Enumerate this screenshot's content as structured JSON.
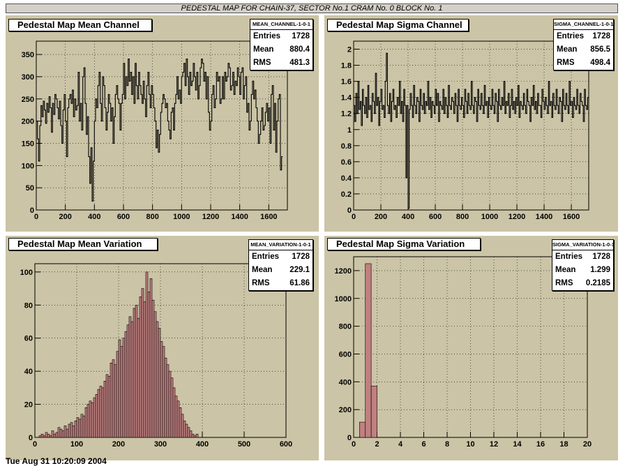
{
  "page_title": "PEDESTAL MAP FOR CHAIN-37, SECTOR No.1 CRAM No. 0 BLOCK No. 1",
  "footer_text": "Tue Aug 31 10:20:09 2004",
  "pads": [
    {
      "title": "Pedestal Map Mean Channel",
      "stats": {
        "name": "MEAN_CHANNEL-1-0-1",
        "entries_label": "Entries",
        "entries": "1728",
        "mean_label": "Mean",
        "mean": "880.4",
        "rms_label": "RMS",
        "rms": "481.3"
      }
    },
    {
      "title": "Pedestal Map Sigma Channel",
      "stats": {
        "name": "SIGMA_CHANNEL-1-0-1",
        "entries_label": "Entries",
        "entries": "1728",
        "mean_label": "Mean",
        "mean": "856.5",
        "rms_label": "RMS",
        "rms": "498.4"
      }
    },
    {
      "title": "Pedestal Map Mean Variation",
      "stats": {
        "name": "MEAN_VARIATION-1-0-1",
        "entries_label": "Entries",
        "entries": "1728",
        "mean_label": "Mean",
        "mean": "229.1",
        "rms_label": "RMS",
        "rms": "61.86"
      }
    },
    {
      "title": "Pedestal Map Sigma Variation",
      "stats": {
        "name": "SIGMA_VARIATION-1-0-1",
        "entries_label": "Entries",
        "entries": "1728",
        "mean_label": "Mean",
        "mean": "1.299",
        "rms_label": "RMS",
        "rms": "0.2185"
      }
    }
  ],
  "colors": {
    "pad_background": "#cbc4a6",
    "hist_fill": "#c08080",
    "line": "#000000"
  },
  "chart_data": [
    {
      "type": "line",
      "title": "Pedestal Map Mean Channel",
      "xlim": [
        0,
        1728
      ],
      "ylim": [
        0,
        380
      ],
      "xticks": [
        "0",
        "200",
        "400",
        "600",
        "800",
        "1000",
        "1200",
        "1400",
        "1600"
      ],
      "yticks": [
        "0",
        "50",
        "100",
        "150",
        "200",
        "250",
        "300",
        "350"
      ],
      "grid": true,
      "bin_width": 8,
      "x": [
        0,
        8,
        16,
        24,
        32,
        40,
        48,
        56,
        64,
        72,
        80,
        88,
        96,
        104,
        112,
        120,
        128,
        136,
        144,
        152,
        160,
        168,
        176,
        184,
        192,
        200,
        208,
        216,
        224,
        232,
        240,
        248,
        256,
        264,
        272,
        280,
        288,
        296,
        304,
        312,
        320,
        328,
        336,
        344,
        352,
        360,
        368,
        376,
        384,
        392,
        400,
        408,
        416,
        424,
        432,
        440,
        448,
        456,
        464,
        472,
        480,
        488,
        496,
        504,
        512,
        520,
        528,
        536,
        544,
        552,
        560,
        568,
        576,
        584,
        592,
        600,
        608,
        616,
        624,
        632,
        640,
        648,
        656,
        664,
        672,
        680,
        688,
        696,
        704,
        712,
        720,
        728,
        736,
        744,
        752,
        760,
        768,
        776,
        784,
        792,
        800,
        808,
        816,
        824,
        832,
        840,
        848,
        856,
        864,
        872,
        880,
        888,
        896,
        904,
        912,
        920,
        928,
        936,
        944,
        952,
        960,
        968,
        976,
        984,
        992,
        1000,
        1008,
        1016,
        1024,
        1032,
        1040,
        1048,
        1056,
        1064,
        1072,
        1080,
        1088,
        1096,
        1104,
        1112,
        1120,
        1128,
        1136,
        1144,
        1152,
        1160,
        1168,
        1176,
        1184,
        1192,
        1200,
        1208,
        1216,
        1224,
        1232,
        1240,
        1248,
        1256,
        1264,
        1272,
        1280,
        1288,
        1296,
        1304,
        1312,
        1320,
        1328,
        1336,
        1344,
        1352,
        1360,
        1368,
        1376,
        1384,
        1392,
        1400,
        1408,
        1416,
        1424,
        1432,
        1440,
        1448,
        1456,
        1464,
        1472,
        1480,
        1488,
        1496,
        1504,
        1512,
        1520,
        1528,
        1536,
        1544,
        1552,
        1560,
        1568,
        1576,
        1584,
        1592,
        1600,
        1608,
        1616,
        1624,
        1632,
        1640,
        1648,
        1656,
        1664,
        1672,
        1680,
        1688,
        1696,
        1704,
        1712,
        1720
      ],
      "series": [
        {
          "values": [
            200,
            160,
            110,
            190,
            235,
            210,
            245,
            225,
            195,
            240,
            220,
            255,
            230,
            175,
            240,
            215,
            260,
            250,
            230,
            205,
            245,
            190,
            150,
            225,
            260,
            200,
            120,
            230,
            250,
            260,
            240,
            270,
            210,
            250,
            225,
            235,
            310,
            200,
            240,
            180,
            300,
            320,
            240,
            170,
            210,
            120,
            60,
            140,
            20,
            110,
            200,
            250,
            230,
            280,
            310,
            240,
            200,
            300,
            280,
            230,
            180,
            220,
            260,
            240,
            200,
            230,
            150,
            210,
            260,
            280,
            250,
            240,
            180,
            240,
            260,
            330,
            250,
            300,
            280,
            340,
            290,
            310,
            260,
            300,
            240,
            330,
            280,
            250,
            310,
            280,
            260,
            240,
            290,
            250,
            210,
            280,
            310,
            260,
            230,
            280,
            260,
            230,
            200,
            140,
            180,
            130,
            170,
            220,
            240,
            260,
            250,
            230,
            240,
            200,
            180,
            160,
            220,
            230,
            180,
            240,
            260,
            300,
            250,
            270,
            240,
            300,
            310,
            330,
            280,
            340,
            300,
            260,
            310,
            280,
            290,
            330,
            300,
            270,
            310,
            250,
            280,
            320,
            340,
            330,
            290,
            310,
            250,
            300,
            220,
            180,
            200,
            260,
            280,
            230,
            250,
            310,
            290,
            300,
            240,
            250,
            300,
            250,
            310,
            290,
            300,
            330,
            320,
            270,
            280,
            310,
            260,
            290,
            280,
            320,
            300,
            260,
            310,
            320,
            250,
            280,
            300,
            220,
            240,
            180,
            200,
            260,
            290,
            250,
            270,
            230,
            200,
            150,
            170,
            200,
            230,
            180,
            190,
            220,
            240,
            200,
            230,
            150,
            260,
            280,
            180,
            240,
            130,
            200,
            250,
            260,
            90,
            120
          ]
        }
      ]
    },
    {
      "type": "line",
      "title": "Pedestal Map Sigma Channel",
      "xlim": [
        0,
        1728
      ],
      "ylim": [
        0,
        2.1
      ],
      "xticks": [
        "0",
        "200",
        "400",
        "600",
        "800",
        "1000",
        "1200",
        "1400",
        "1600"
      ],
      "yticks": [
        "0",
        "0.2",
        "0.4",
        "0.6",
        "0.8",
        "1",
        "1.2",
        "1.4",
        "1.6",
        "1.8",
        "2"
      ],
      "grid": true,
      "bin_width": 8,
      "x": [
        0,
        8,
        16,
        24,
        32,
        40,
        48,
        56,
        64,
        72,
        80,
        88,
        96,
        104,
        112,
        120,
        128,
        136,
        144,
        152,
        160,
        168,
        176,
        184,
        192,
        200,
        208,
        216,
        224,
        232,
        240,
        248,
        256,
        264,
        272,
        280,
        288,
        296,
        304,
        312,
        320,
        328,
        336,
        344,
        352,
        360,
        368,
        376,
        384,
        392,
        400,
        408,
        416,
        424,
        432,
        440,
        448,
        456,
        464,
        472,
        480,
        488,
        496,
        504,
        512,
        520,
        528,
        536,
        544,
        552,
        560,
        568,
        576,
        584,
        592,
        600,
        608,
        616,
        624,
        632,
        640,
        648,
        656,
        664,
        672,
        680,
        688,
        696,
        704,
        712,
        720,
        728,
        736,
        744,
        752,
        760,
        768,
        776,
        784,
        792,
        800,
        808,
        816,
        824,
        832,
        840,
        848,
        856,
        864,
        872,
        880,
        888,
        896,
        904,
        912,
        920,
        928,
        936,
        944,
        952,
        960,
        968,
        976,
        984,
        992,
        1000,
        1008,
        1016,
        1024,
        1032,
        1040,
        1048,
        1056,
        1064,
        1072,
        1080,
        1088,
        1096,
        1104,
        1112,
        1120,
        1128,
        1136,
        1144,
        1152,
        1160,
        1168,
        1176,
        1184,
        1192,
        1200,
        1208,
        1216,
        1224,
        1232,
        1240,
        1248,
        1256,
        1264,
        1272,
        1280,
        1288,
        1296,
        1304,
        1312,
        1320,
        1328,
        1336,
        1344,
        1352,
        1360,
        1368,
        1376,
        1384,
        1392,
        1400,
        1408,
        1416,
        1424,
        1432,
        1440,
        1448,
        1456,
        1464,
        1472,
        1480,
        1488,
        1496,
        1504,
        1512,
        1520,
        1528,
        1536,
        1544,
        1552,
        1560,
        1568,
        1576,
        1584,
        1592,
        1600,
        1608,
        1616,
        1624,
        1632,
        1640,
        1648,
        1656,
        1664,
        1672,
        1680,
        1688,
        1696,
        1704,
        1712,
        1720
      ],
      "series": [
        {
          "values": [
            1.3,
            1.1,
            1.45,
            1.2,
            1.6,
            1.25,
            1.35,
            1.05,
            1.5,
            1.3,
            1.2,
            1.4,
            1.15,
            1.55,
            1.25,
            1.3,
            1.1,
            1.45,
            1.35,
            1.2,
            1.7,
            1.3,
            1.4,
            1.05,
            1.35,
            1.5,
            1.25,
            1.3,
            1.15,
            1.6,
            1.95,
            1.3,
            1.2,
            1.45,
            1.1,
            1.35,
            1.5,
            1.25,
            1.3,
            1.15,
            1.4,
            1.3,
            1.6,
            1.2,
            1.35,
            1.1,
            1.5,
            1.3,
            0.4,
            1.3,
            0.02,
            1.25,
            1.45,
            1.3,
            1.15,
            1.55,
            1.3,
            1.2,
            1.4,
            1.35,
            1.1,
            1.5,
            1.3,
            1.25,
            1.45,
            1.2,
            1.35,
            1.3,
            1.6,
            1.25,
            1.4,
            1.15,
            1.35,
            1.3,
            1.2,
            1.5,
            1.3,
            1.45,
            1.1,
            1.35,
            1.3,
            1.25,
            1.5,
            1.2,
            1.4,
            1.3,
            1.15,
            1.55,
            1.3,
            1.25,
            1.4,
            1.35,
            1.2,
            1.45,
            1.3,
            1.1,
            1.5,
            1.3,
            1.25,
            1.4,
            1.3,
            1.15,
            1.5,
            1.35,
            1.2,
            1.45,
            1.3,
            1.25,
            1.6,
            1.3,
            1.2,
            1.4,
            1.35,
            1.1,
            1.5,
            1.3,
            1.25,
            1.45,
            1.3,
            1.2,
            1.55,
            1.3,
            1.35,
            1.15,
            1.4,
            1.3,
            1.25,
            1.5,
            1.3,
            1.2,
            1.45,
            1.35,
            1.1,
            1.5,
            1.3,
            1.25,
            1.4,
            1.3,
            1.6,
            1.2,
            1.35,
            1.3,
            1.45,
            1.15,
            1.3,
            1.5,
            1.25,
            1.35,
            1.2,
            1.4,
            1.3,
            1.55,
            1.15,
            1.35,
            1.3,
            1.25,
            1.45,
            1.3,
            1.2,
            1.5,
            1.35,
            1.3,
            1.1,
            1.4,
            1.3,
            1.55,
            1.25,
            1.35,
            1.2,
            1.45,
            1.3,
            1.3,
            1.15,
            1.5,
            1.35,
            1.25,
            1.4,
            1.3,
            1.2,
            1.6,
            1.3,
            1.35,
            1.15,
            1.45,
            1.3,
            1.25,
            1.5,
            1.3,
            1.2,
            1.4,
            1.35,
            1.1,
            1.5,
            1.3,
            1.25,
            1.45,
            1.3,
            1.2,
            1.6,
            1.3,
            1.35,
            1.15,
            1.4,
            1.3,
            1.25,
            1.5,
            1.3,
            1.2,
            1.45,
            1.35,
            1.3,
            1.1,
            1.5,
            1.3,
            1.25,
            1.4,
            1.3,
            1.2
          ]
        }
      ]
    },
    {
      "type": "bar",
      "title": "Pedestal Map Mean Variation",
      "xlim": [
        0,
        600
      ],
      "ylim": [
        0,
        105
      ],
      "xticks": [
        "0",
        "100",
        "200",
        "300",
        "400",
        "500",
        "600"
      ],
      "yticks": [
        "0",
        "20",
        "40",
        "60",
        "80",
        "100"
      ],
      "grid": true,
      "bin_width": 5,
      "x": [
        0,
        5,
        10,
        15,
        20,
        25,
        30,
        35,
        40,
        45,
        50,
        55,
        60,
        65,
        70,
        75,
        80,
        85,
        90,
        95,
        100,
        105,
        110,
        115,
        120,
        125,
        130,
        135,
        140,
        145,
        150,
        155,
        160,
        165,
        170,
        175,
        180,
        185,
        190,
        195,
        200,
        205,
        210,
        215,
        220,
        225,
        230,
        235,
        240,
        245,
        250,
        255,
        260,
        265,
        270,
        275,
        280,
        285,
        290,
        295,
        300,
        305,
        310,
        315,
        320,
        325,
        330,
        335,
        340,
        345,
        350,
        355,
        360,
        365,
        370,
        375,
        380,
        385,
        390,
        395
      ],
      "series": [
        {
          "name": "MEAN_VARIATION-1-0-1",
          "values": [
            0,
            0,
            1,
            2,
            1,
            3,
            2,
            1,
            4,
            2,
            3,
            6,
            5,
            4,
            7,
            5,
            8,
            9,
            7,
            10,
            12,
            11,
            14,
            13,
            18,
            20,
            22,
            21,
            24,
            26,
            29,
            31,
            30,
            34,
            38,
            37,
            45,
            47,
            44,
            52,
            59,
            55,
            60,
            64,
            68,
            73,
            70,
            78,
            80,
            72,
            85,
            90,
            82,
            100,
            88,
            96,
            83,
            76,
            70,
            66,
            58,
            55,
            48,
            44,
            40,
            36,
            30,
            25,
            22,
            18,
            14,
            10,
            8,
            6,
            4,
            2,
            1,
            2,
            0,
            0
          ]
        }
      ]
    },
    {
      "type": "bar",
      "title": "Pedestal Map Sigma Variation",
      "xlim": [
        0,
        20
      ],
      "ylim": [
        0,
        1300
      ],
      "xticks": [
        "0",
        "2",
        "4",
        "6",
        "8",
        "10",
        "12",
        "14",
        "16",
        "18",
        "20"
      ],
      "yticks": [
        "0",
        "200",
        "400",
        "600",
        "800",
        "1000",
        "1200"
      ],
      "grid": true,
      "bin_width": 0.5,
      "x": [
        0.5,
        1.0,
        1.5
      ],
      "series": [
        {
          "name": "SIGMA_VARIATION-1-0-1",
          "values": [
            110,
            1250,
            370
          ]
        }
      ]
    }
  ]
}
